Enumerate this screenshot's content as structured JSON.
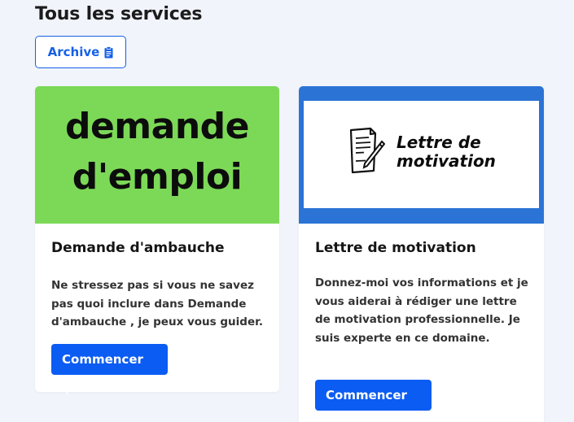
{
  "header": {
    "title": "Tous les services"
  },
  "archive_button": {
    "label": "Archive",
    "icon": "clipboard-icon"
  },
  "services": [
    {
      "thumbnail_lines": [
        "demande",
        "d'emploi"
      ],
      "thumbnail_bg": "#7cd957",
      "title": "Demande d'ambauche",
      "description": "Ne stressez pas si vous ne savez pas quoi inclure dans Demande d'ambauche , je peux vous guider.",
      "button_label": "Commencer +"
    },
    {
      "thumbnail_text": "Lettre de motivation",
      "thumbnail_icon": "document-pen-icon",
      "thumbnail_bg": "#2b74d6",
      "title": "Lettre de motivation",
      "description": "Donnez-moi vos informations et je vous aiderai à rédiger une lettre de motivation professionnelle. Je suis experte en ce domaine.",
      "button_label": "Commencer +"
    }
  ],
  "colors": {
    "primary": "#0b5cf2",
    "background": "#f1f4fb"
  }
}
